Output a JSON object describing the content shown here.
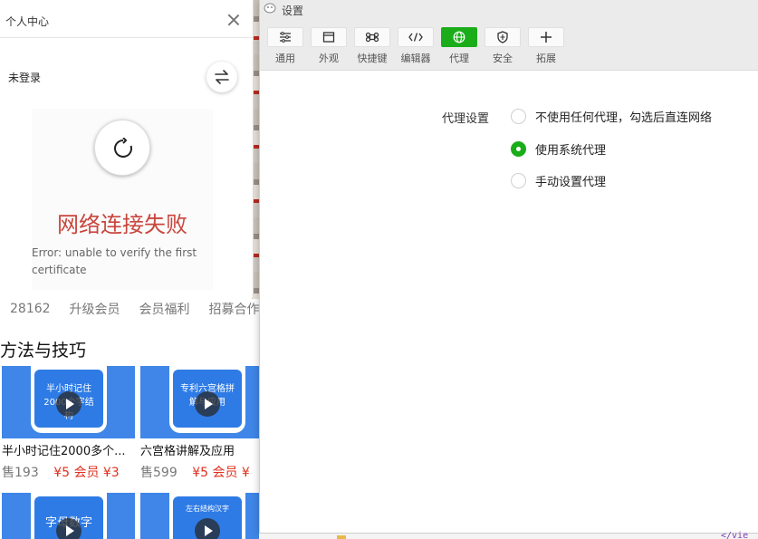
{
  "background_page": {
    "stats": [
      "28162",
      "升级会员",
      "会员福利",
      "招募合作"
    ],
    "section_title": "方法与技巧",
    "courses": [
      {
        "title": "半小时记住2000多个...",
        "sold": "售193",
        "price": "¥5 会员 ¥3",
        "thumb_caption": "半小时记住2000个字结构"
      },
      {
        "title": "六宫格讲解及应用",
        "sold": "售599",
        "price": "¥5 会员 ¥",
        "thumb_caption": "专利六宫格拼解与应用"
      },
      {
        "title": "",
        "sold": "",
        "price": "",
        "thumb_caption": "字母数字"
      },
      {
        "title": "",
        "sold": "",
        "price": "",
        "thumb_caption": "左右结构汉字"
      }
    ]
  },
  "personal_center": {
    "title": "个人中心",
    "login_status": "未登录",
    "error_title": "网络连接失败",
    "error_message": "Error: unable to verify the first certificate",
    "icons": {
      "close": "close-icon",
      "swap": "swap-icon",
      "reload": "reload-icon"
    }
  },
  "settings": {
    "window_title": "设置",
    "tabs": [
      {
        "label": "通用",
        "icon": "sliders-icon",
        "active": false
      },
      {
        "label": "外观",
        "icon": "window-icon",
        "active": false
      },
      {
        "label": "快捷键",
        "icon": "command-icon",
        "active": false
      },
      {
        "label": "编辑器",
        "icon": "code-icon",
        "active": false
      },
      {
        "label": "代理",
        "icon": "globe-icon",
        "active": true
      },
      {
        "label": "安全",
        "icon": "shield-icon",
        "active": false
      },
      {
        "label": "拓展",
        "icon": "plus-icon",
        "active": false
      }
    ],
    "proxy": {
      "label": "代理设置",
      "options": [
        {
          "text": "不使用任何代理，勾选后直连网络",
          "selected": false
        },
        {
          "text": "使用系统代理",
          "selected": true
        },
        {
          "text": "手动设置代理",
          "selected": false
        }
      ]
    },
    "accent_color": "#1aad19"
  },
  "behind_window": {
    "code_fragment": "</vie"
  }
}
